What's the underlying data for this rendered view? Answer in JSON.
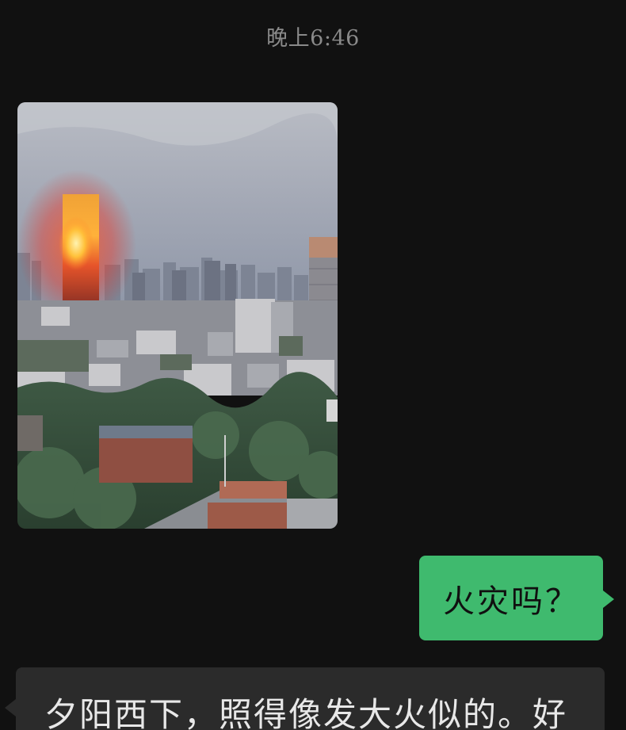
{
  "chat": {
    "timestamp": "晚上6:46",
    "messages": [
      {
        "direction": "incoming",
        "type": "image",
        "image_subject": "city-sunset-photo"
      },
      {
        "direction": "outgoing",
        "type": "text",
        "text": "火灾吗？"
      },
      {
        "direction": "incoming",
        "type": "text",
        "text": "夕阳西下，照得像发大火似的。好"
      }
    ]
  },
  "colors": {
    "background": "#111111",
    "outgoing_bubble": "#3fba6e",
    "incoming_bubble": "#2b2b2b",
    "timestamp_text": "#8a8a8a"
  }
}
